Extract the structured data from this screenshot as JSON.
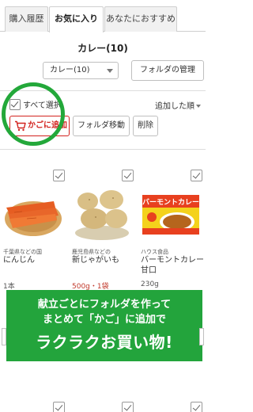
{
  "tabs": [
    {
      "label": "購入履歴",
      "active": false
    },
    {
      "label": "お気に入り",
      "active": true
    },
    {
      "label": "あなたにおすすめ",
      "active": false
    }
  ],
  "folder": {
    "title": "カレー(10)",
    "select_value": "カレー(10)",
    "manage_label": "フォルダの管理"
  },
  "toolbar": {
    "select_all_label": "すべて選択",
    "sort_label": "追加した順",
    "cart_label": "かごに追加",
    "move_label": "フォルダ移動",
    "delete_label": "削除"
  },
  "products": [
    {
      "maker": "千葉県などの国",
      "name": "にんじん",
      "qty": "1本",
      "qty_highlight": false,
      "image": "carrot-image"
    },
    {
      "maker": "鹿児島県などの",
      "name": "新じゃがいも",
      "qty": "500g・1袋",
      "qty_highlight": true,
      "image": "potato-image"
    },
    {
      "maker": "ハウス食品",
      "name": "バーモントカレー甘口",
      "qty": "230g",
      "qty_highlight": false,
      "image": "curry-box-image",
      "package_text": "バーモントカレー"
    }
  ],
  "banner": {
    "line1": "献立ごとにフォルダを作って",
    "line2": "まとめて「かご」に追加で",
    "line3": "ラクラクお買い物!"
  },
  "colors": {
    "accent_red": "#d2231f",
    "banner_green": "#23a43c",
    "highlight_green": "#23a83a"
  }
}
